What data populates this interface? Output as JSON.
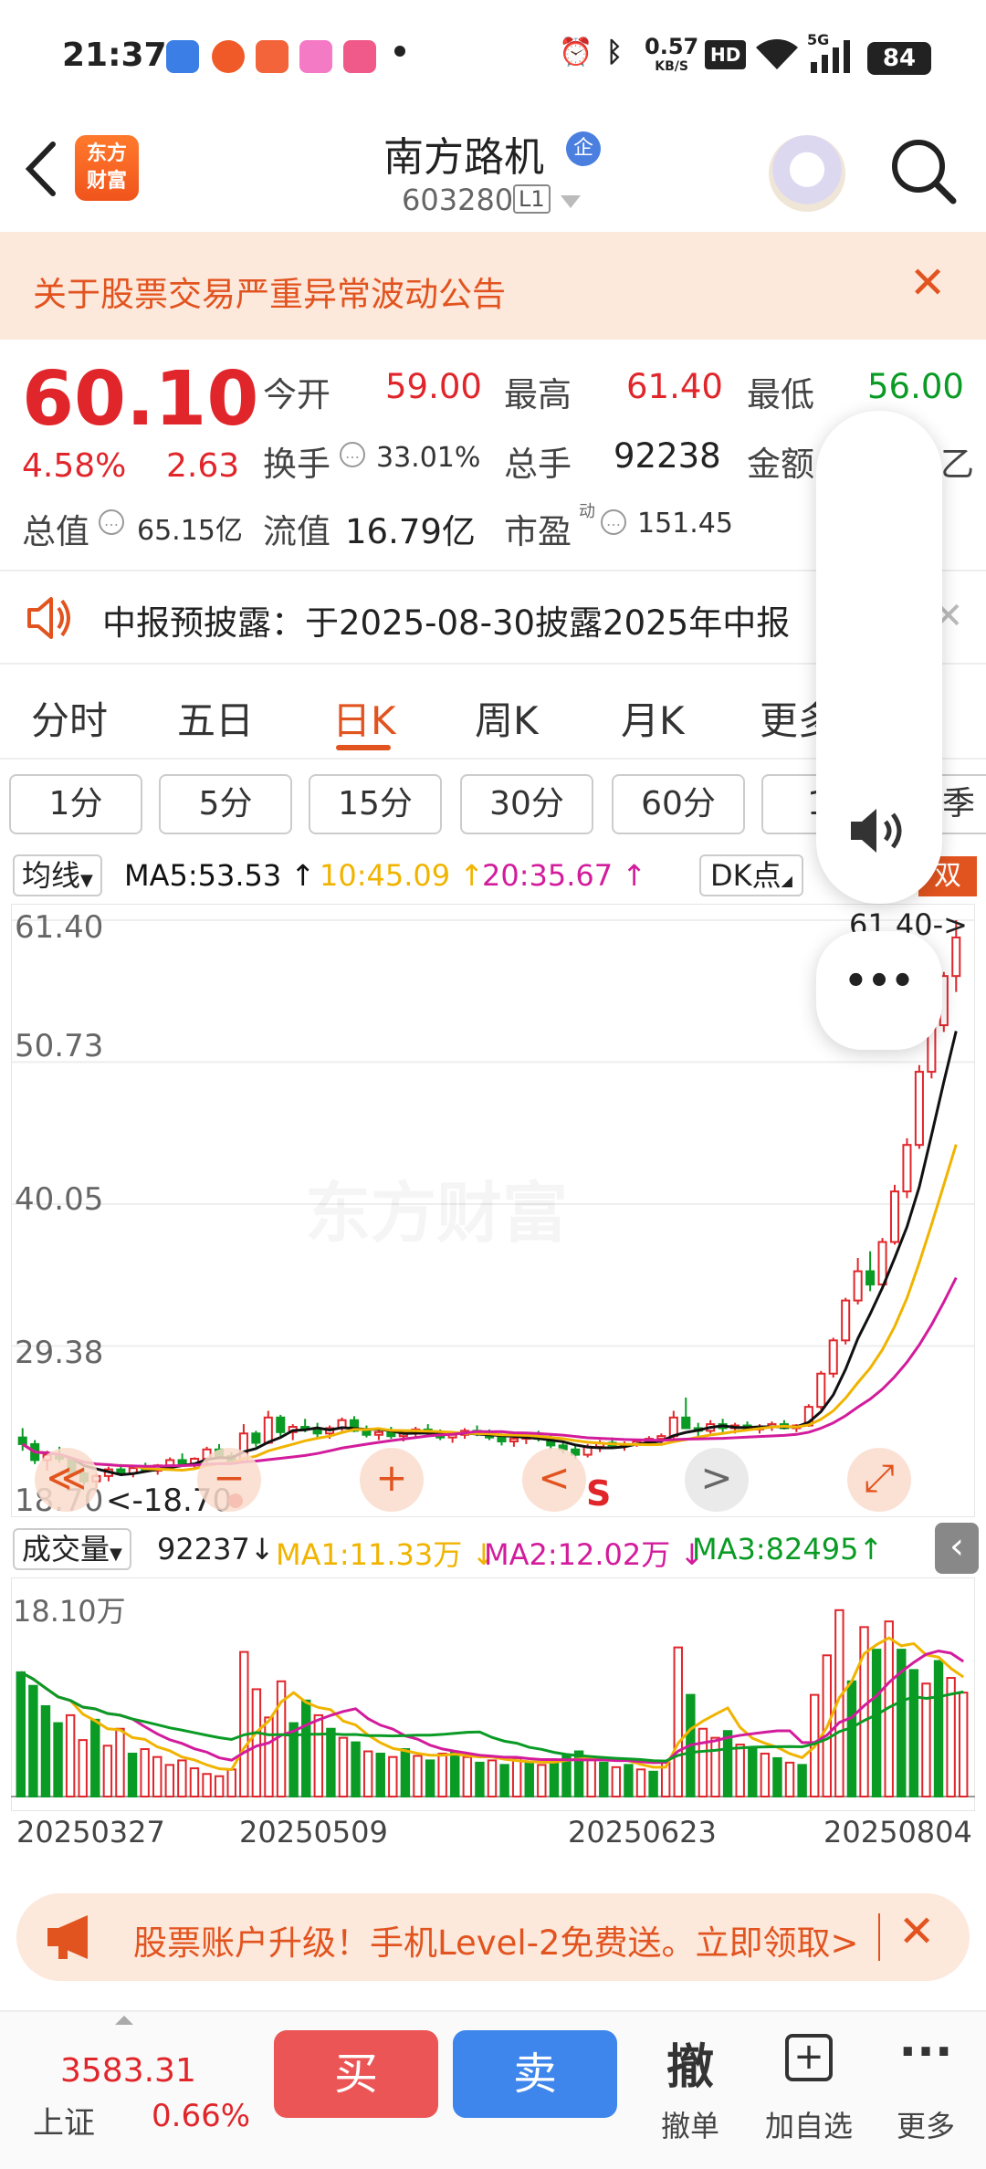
{
  "status": {
    "time": "21:37",
    "net_speed": "0.57",
    "net_unit": "KB/S",
    "hd": "HD",
    "signal": "5G",
    "battery": "84"
  },
  "header": {
    "logo_line1": "东方",
    "logo_line2": "财富",
    "name": "南方路机",
    "badge": "企",
    "code": "603280",
    "level": "L1"
  },
  "notice": {
    "text": "关于股票交易严重异常波动公告"
  },
  "quote": {
    "price": "60.10",
    "pct": "4.58%",
    "change": "2.63",
    "open_label": "今开",
    "open": "59.00",
    "high_label": "最高",
    "high": "61.40",
    "low_label": "最低",
    "low": "56.00",
    "turnover_label": "换手",
    "turnover": "33.01%",
    "volume_label": "总手",
    "volume": "92238",
    "amount_label": "金额",
    "amount_tail": "乙",
    "mcap_label": "总值",
    "mcap": "65.15亿",
    "float_label": "流值",
    "float": "16.79亿",
    "pe_label": "市盈",
    "pe_sup": "动",
    "pe": "151.45"
  },
  "announcement": {
    "text": "中报预披露：于2025-08-30披露2025年中报"
  },
  "tabs": [
    {
      "label": "分时"
    },
    {
      "label": "五日"
    },
    {
      "label": "日K"
    },
    {
      "label": "周K"
    },
    {
      "label": "月K"
    },
    {
      "label": "更多"
    }
  ],
  "periods": [
    "1分",
    "5分",
    "15分",
    "30分",
    "60分",
    "12",
    "季"
  ],
  "legend": {
    "junxian": "均线",
    "ma5": "MA5:53.53",
    "ma10": "10:45.09",
    "ma20": "20:35.67",
    "dk": "DK点",
    "fuquan": "双"
  },
  "price_axis": [
    "61.40",
    "50.73",
    "40.05",
    "29.38",
    "18.70"
  ],
  "annotations": {
    "high_marker": "61.40->",
    "low_marker": "<-18.70",
    "s_marker": "S",
    "watermark": "东方财富"
  },
  "controls": {
    "back": "≪",
    "minus": "−",
    "plus": "+",
    "prev": "<",
    "next": ">",
    "expand": "⤢"
  },
  "volume_legend": {
    "selector": "成交量",
    "vol": "92237",
    "ma1": "MA1:11.33万",
    "ma2": "MA2:12.02万",
    "ma3": "MA3:82495",
    "top": "18.10万"
  },
  "dates": [
    "20250327",
    "20250509",
    "20250623",
    "20250804"
  ],
  "promo": {
    "text": "股票账户升级！手机Level-2免费送。立即领取>"
  },
  "bottom": {
    "index_value": "3583.31",
    "index_name": "上证",
    "index_pct": "0.66%",
    "buy": "买",
    "sell": "卖",
    "cancel_icon": "撤",
    "cancel_label": "撤单",
    "add_label": "加自选",
    "more_label": "更多"
  },
  "colors": {
    "up": "#e0262b",
    "down": "#0a9b25",
    "accent": "#e2541f",
    "ma5": "#111111",
    "ma10": "#f0b400",
    "ma20": "#d21c9c"
  },
  "chart_data": {
    "type": "candlestick",
    "ylim": [
      18.7,
      61.4
    ],
    "candles": [
      [
        22.5,
        23.2,
        21.5,
        22.0
      ],
      [
        22.0,
        22.3,
        20.5,
        20.8
      ],
      [
        20.8,
        21.5,
        20.0,
        21.2
      ],
      [
        21.2,
        21.8,
        20.6,
        20.9
      ],
      [
        20.9,
        21.0,
        19.5,
        19.8
      ],
      [
        19.8,
        20.2,
        18.9,
        19.2
      ],
      [
        19.2,
        19.8,
        18.7,
        19.6
      ],
      [
        19.6,
        20.3,
        19.2,
        20.1
      ],
      [
        20.1,
        20.5,
        19.6,
        19.8
      ],
      [
        19.8,
        20.4,
        19.5,
        20.2
      ],
      [
        20.2,
        20.6,
        19.9,
        20.0
      ],
      [
        20.0,
        20.5,
        19.7,
        20.4
      ],
      [
        20.4,
        21.0,
        20.1,
        20.8
      ],
      [
        20.8,
        21.3,
        20.3,
        20.5
      ],
      [
        20.5,
        21.0,
        20.2,
        20.9
      ],
      [
        20.9,
        21.8,
        20.6,
        21.6
      ],
      [
        21.6,
        22.0,
        20.9,
        21.1
      ],
      [
        21.1,
        21.4,
        20.5,
        20.7
      ],
      [
        20.7,
        23.5,
        20.6,
        22.8
      ],
      [
        22.8,
        23.0,
        21.8,
        22.1
      ],
      [
        22.1,
        24.5,
        22.0,
        24.0
      ],
      [
        24.0,
        24.2,
        22.6,
        22.9
      ],
      [
        22.9,
        23.5,
        22.3,
        23.3
      ],
      [
        23.3,
        23.9,
        22.9,
        23.1
      ],
      [
        23.1,
        23.6,
        22.5,
        22.8
      ],
      [
        22.8,
        23.4,
        22.4,
        23.2
      ],
      [
        23.2,
        24.0,
        23.0,
        23.8
      ],
      [
        23.8,
        24.1,
        22.9,
        23.0
      ],
      [
        23.0,
        23.4,
        22.5,
        22.7
      ],
      [
        22.7,
        23.1,
        22.3,
        22.9
      ],
      [
        22.9,
        23.3,
        22.4,
        22.6
      ],
      [
        22.6,
        23.0,
        22.2,
        22.8
      ],
      [
        22.8,
        23.3,
        22.5,
        23.1
      ],
      [
        23.1,
        23.5,
        22.6,
        22.8
      ],
      [
        22.8,
        23.1,
        22.3,
        22.5
      ],
      [
        22.5,
        22.9,
        22.1,
        22.7
      ],
      [
        22.7,
        23.2,
        22.4,
        23.0
      ],
      [
        23.0,
        23.4,
        22.6,
        22.8
      ],
      [
        22.8,
        23.1,
        22.3,
        22.5
      ],
      [
        22.5,
        22.8,
        21.9,
        22.2
      ],
      [
        22.2,
        22.6,
        21.8,
        22.4
      ],
      [
        22.4,
        22.8,
        22.0,
        22.6
      ],
      [
        22.6,
        23.0,
        22.2,
        22.4
      ],
      [
        22.4,
        22.7,
        21.6,
        21.9
      ],
      [
        21.9,
        22.2,
        21.3,
        21.6
      ],
      [
        21.6,
        21.9,
        20.9,
        21.2
      ],
      [
        21.2,
        22.0,
        21.0,
        21.8
      ],
      [
        21.8,
        22.3,
        21.4,
        22.1
      ],
      [
        22.1,
        22.5,
        21.7,
        21.9
      ],
      [
        21.9,
        22.2,
        21.5,
        22.0
      ],
      [
        22.0,
        22.4,
        21.8,
        22.2
      ],
      [
        22.2,
        22.6,
        21.9,
        22.4
      ],
      [
        22.4,
        22.8,
        22.0,
        22.6
      ],
      [
        22.6,
        24.5,
        22.4,
        24.0
      ],
      [
        24.0,
        25.5,
        23.8,
        23.2
      ],
      [
        23.2,
        23.6,
        22.6,
        23.0
      ],
      [
        23.0,
        23.8,
        22.8,
        23.5
      ],
      [
        23.5,
        23.9,
        22.9,
        23.2
      ],
      [
        23.2,
        23.6,
        22.8,
        23.4
      ],
      [
        23.4,
        23.7,
        23.0,
        23.1
      ],
      [
        23.1,
        23.5,
        22.8,
        23.3
      ],
      [
        23.3,
        23.7,
        23.0,
        23.5
      ],
      [
        23.5,
        23.8,
        23.1,
        23.2
      ],
      [
        23.2,
        23.5,
        22.9,
        23.4
      ],
      [
        23.4,
        25.0,
        23.3,
        24.8
      ],
      [
        24.8,
        27.5,
        24.6,
        27.3
      ],
      [
        27.3,
        30.0,
        27.0,
        29.8
      ],
      [
        29.8,
        33.0,
        29.5,
        32.8
      ],
      [
        32.8,
        36.0,
        32.5,
        35.0
      ],
      [
        35.0,
        36.5,
        33.5,
        34.0
      ],
      [
        34.0,
        37.5,
        33.8,
        37.2
      ],
      [
        37.2,
        41.5,
        37.0,
        41.0
      ],
      [
        41.0,
        45.0,
        40.5,
        44.5
      ],
      [
        44.5,
        50.5,
        44.2,
        50.0
      ],
      [
        50.0,
        54.0,
        49.5,
        53.5
      ],
      [
        53.5,
        57.5,
        53.0,
        57.2
      ],
      [
        57.2,
        61.4,
        56.0,
        60.1
      ]
    ],
    "volume": [
      [
        11.0,
        0
      ],
      [
        9.8,
        0
      ],
      [
        8.0,
        0
      ],
      [
        6.5,
        0
      ],
      [
        7.2,
        1
      ],
      [
        5.0,
        1
      ],
      [
        6.8,
        0
      ],
      [
        4.5,
        1
      ],
      [
        6.0,
        1
      ],
      [
        3.8,
        0
      ],
      [
        4.2,
        1
      ],
      [
        3.5,
        1
      ],
      [
        2.8,
        1
      ],
      [
        3.2,
        1
      ],
      [
        2.5,
        1
      ],
      [
        2.0,
        1
      ],
      [
        1.8,
        1
      ],
      [
        2.4,
        1
      ],
      [
        12.8,
        1
      ],
      [
        9.5,
        1
      ],
      [
        7.0,
        1
      ],
      [
        10.2,
        1
      ],
      [
        6.5,
        0
      ],
      [
        8.5,
        0
      ],
      [
        7.2,
        1
      ],
      [
        6.0,
        0
      ],
      [
        5.2,
        1
      ],
      [
        4.8,
        0
      ],
      [
        4.0,
        1
      ],
      [
        3.8,
        0
      ],
      [
        3.5,
        1
      ],
      [
        4.2,
        0
      ],
      [
        3.6,
        1
      ],
      [
        3.2,
        0
      ],
      [
        3.8,
        1
      ],
      [
        4.0,
        0
      ],
      [
        3.5,
        1
      ],
      [
        3.0,
        0
      ],
      [
        3.2,
        1
      ],
      [
        2.8,
        0
      ],
      [
        3.4,
        1
      ],
      [
        3.0,
        0
      ],
      [
        2.8,
        1
      ],
      [
        3.2,
        0
      ],
      [
        3.6,
        0
      ],
      [
        4.0,
        0
      ],
      [
        3.4,
        1
      ],
      [
        3.0,
        0
      ],
      [
        2.6,
        1
      ],
      [
        2.8,
        0
      ],
      [
        2.4,
        1
      ],
      [
        2.2,
        0
      ],
      [
        3.0,
        1
      ],
      [
        13.2,
        1
      ],
      [
        9.0,
        0
      ],
      [
        6.0,
        1
      ],
      [
        5.2,
        1
      ],
      [
        5.8,
        0
      ],
      [
        4.6,
        1
      ],
      [
        4.2,
        0
      ],
      [
        3.8,
        1
      ],
      [
        3.4,
        0
      ],
      [
        3.0,
        1
      ],
      [
        2.8,
        0
      ],
      [
        9.0,
        1
      ],
      [
        12.5,
        1
      ],
      [
        16.5,
        1
      ],
      [
        10.2,
        0
      ],
      [
        15.0,
        1
      ],
      [
        13.0,
        0
      ],
      [
        15.5,
        1
      ],
      [
        13.0,
        0
      ],
      [
        11.2,
        0
      ],
      [
        10.0,
        1
      ],
      [
        12.0,
        0
      ],
      [
        10.5,
        1
      ],
      [
        9.2,
        1
      ]
    ]
  }
}
